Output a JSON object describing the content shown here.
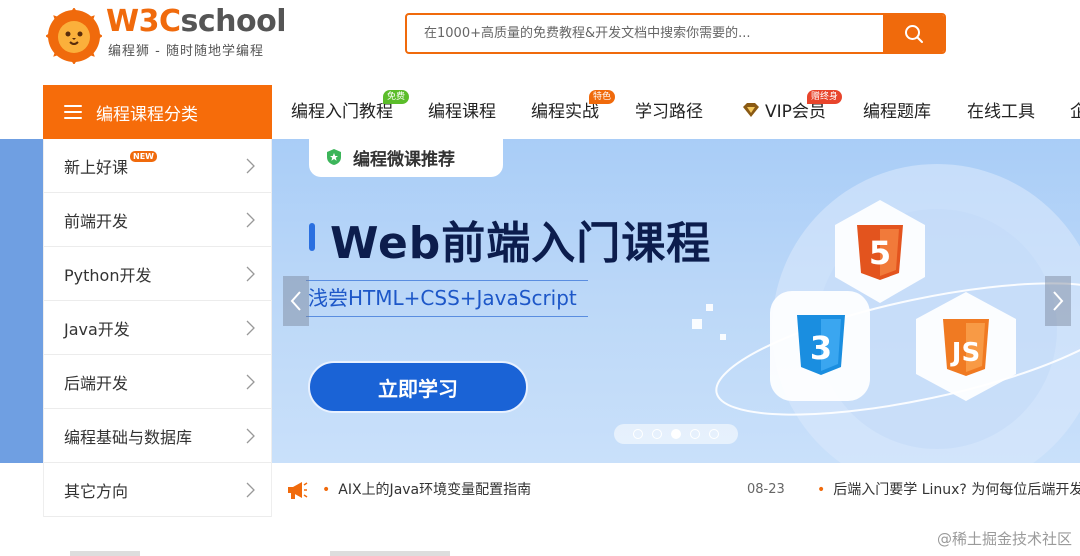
{
  "header": {
    "logo_name_colored": "W3C",
    "logo_name_rest": "school",
    "slogan": "编程狮 - 随时随地学编程",
    "search": {
      "placeholder": "在1000+高质量的免费教程&开发文档中搜索你需要的...",
      "button_icon": "search-icon"
    }
  },
  "nav": {
    "category_button": "编程课程分类",
    "items": [
      {
        "label": "编程入门教程",
        "badge": "免费",
        "badge_color": "#5bbd2a"
      },
      {
        "label": "编程课程"
      },
      {
        "label": "编程实战",
        "badge": "特色",
        "badge_color": "#f06a0c"
      },
      {
        "label": "学习路径"
      },
      {
        "label": "VIP会员",
        "icon": "vip-diamond-icon",
        "badge": "赠终身",
        "badge_color": "#e8452c"
      },
      {
        "label": "编程题库"
      },
      {
        "label": "在线工具"
      },
      {
        "label": "企"
      }
    ]
  },
  "sidebar": {
    "items": [
      {
        "label": "新上好课",
        "badge": "NEW"
      },
      {
        "label": "前端开发"
      },
      {
        "label": "Python开发"
      },
      {
        "label": "Java开发"
      },
      {
        "label": "后端开发"
      },
      {
        "label": "编程基础与数据库"
      },
      {
        "label": "其它方向"
      }
    ]
  },
  "banner": {
    "tag": "编程微课推荐",
    "title": "Web前端入门课程",
    "subtitle": "浅尝HTML+CSS+JavaScript",
    "cta": "立即学习",
    "badges": [
      "HTML5",
      "CSS3",
      "JS"
    ],
    "slide_count": 5,
    "active_slide": 3,
    "accent_color": "#1a63d6"
  },
  "news": {
    "items": [
      {
        "title": "AIX上的Java环境变量配置指南",
        "date": "08-23"
      },
      {
        "title": "后端入门要学 Linux? 为何每位后端开发"
      }
    ]
  },
  "watermark": "@稀土掘金技术社区"
}
